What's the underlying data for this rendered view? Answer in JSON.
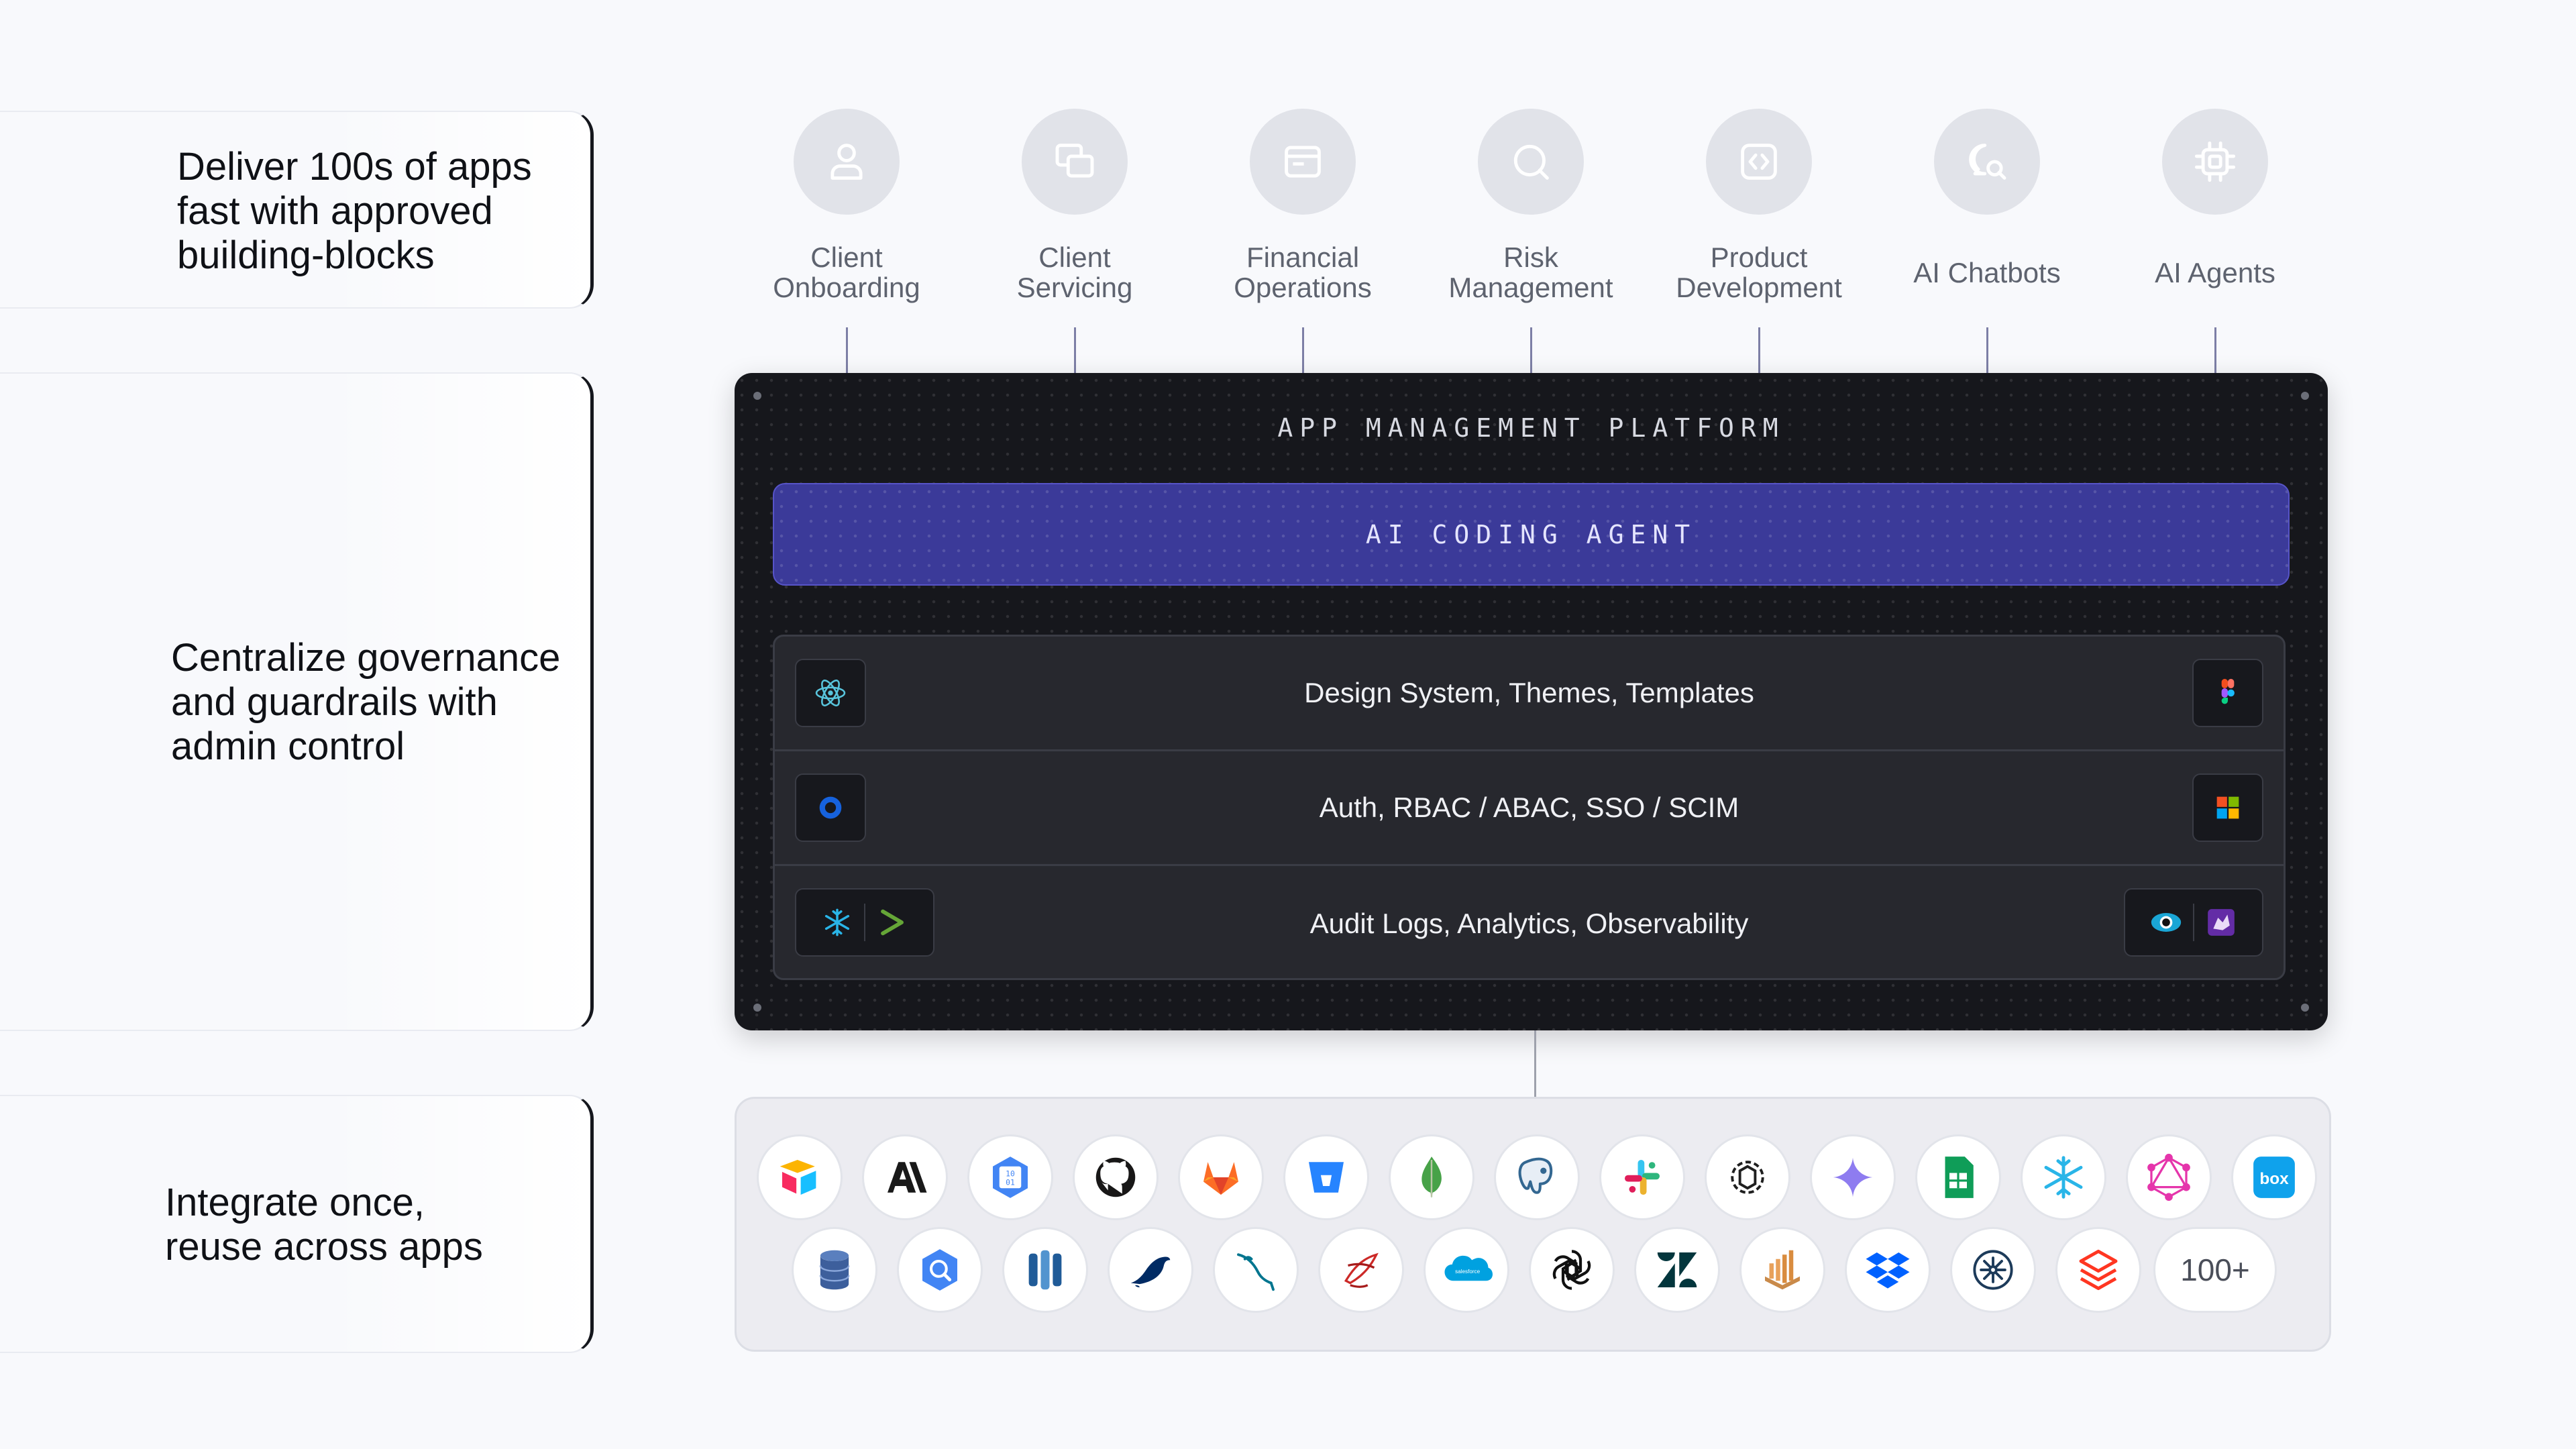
{
  "brackets": [
    {
      "text": "Deliver 100s of apps\nfast with approved\nbuilding-blocks"
    },
    {
      "text": "Centralize governance\nand guardrails with\nadmin control"
    },
    {
      "text": "Integrate once,\nreuse across apps"
    }
  ],
  "categories": [
    {
      "label": "Client\nOnboarding",
      "icon": "user-icon"
    },
    {
      "label": "Client\nServicing",
      "icon": "chat-windows-icon"
    },
    {
      "label": "Financial\nOperations",
      "icon": "card-icon"
    },
    {
      "label": "Risk\nManagement",
      "icon": "search-icon"
    },
    {
      "label": "Product\nDevelopment",
      "icon": "code-icon"
    },
    {
      "label": "AI Chatbots",
      "icon": "chat-search-icon"
    },
    {
      "label": "AI Agents",
      "icon": "chip-icon"
    }
  ],
  "platform": {
    "title": "APP MANAGEMENT PLATFORM",
    "agent": "AI CODING AGENT",
    "rows": [
      {
        "label": "Design System, Themes, Templates",
        "left_icons": [
          "react-icon"
        ],
        "right_icons": [
          "figma-icon"
        ]
      },
      {
        "label": "Auth, RBAC / ABAC, SSO / SCIM",
        "left_icons": [
          "okta-icon"
        ],
        "right_icons": [
          "microsoft-icon"
        ]
      },
      {
        "label": "Audit Logs, Analytics, Observability",
        "left_icons": [
          "snowflake-icon",
          "splunk-icon"
        ],
        "right_icons": [
          "eye-icon",
          "datadog-icon"
        ]
      }
    ]
  },
  "integrations": {
    "row1": [
      "airtable-icon",
      "anthropic-icon",
      "binary-icon",
      "github-icon",
      "gitlab-icon",
      "bitbucket-icon",
      "mongodb-icon",
      "postgres-icon",
      "slack-icon",
      "openai-knot-icon",
      "gemini-icon",
      "google-sheets-icon",
      "snowflake-icon",
      "graphql-icon",
      "box-icon"
    ],
    "row2": [
      "database-icon",
      "bigquery-icon",
      "redshift-icon",
      "mariadb-icon",
      "mysql-icon",
      "sqlserver-icon",
      "salesforce-icon",
      "openai-icon",
      "zendesk-icon",
      "databricks-bars-icon",
      "dropbox-icon",
      "circleci-icon",
      "databricks-icon"
    ],
    "more_label": "100+",
    "box_label": "box",
    "salesforce_label": "salesforce"
  }
}
